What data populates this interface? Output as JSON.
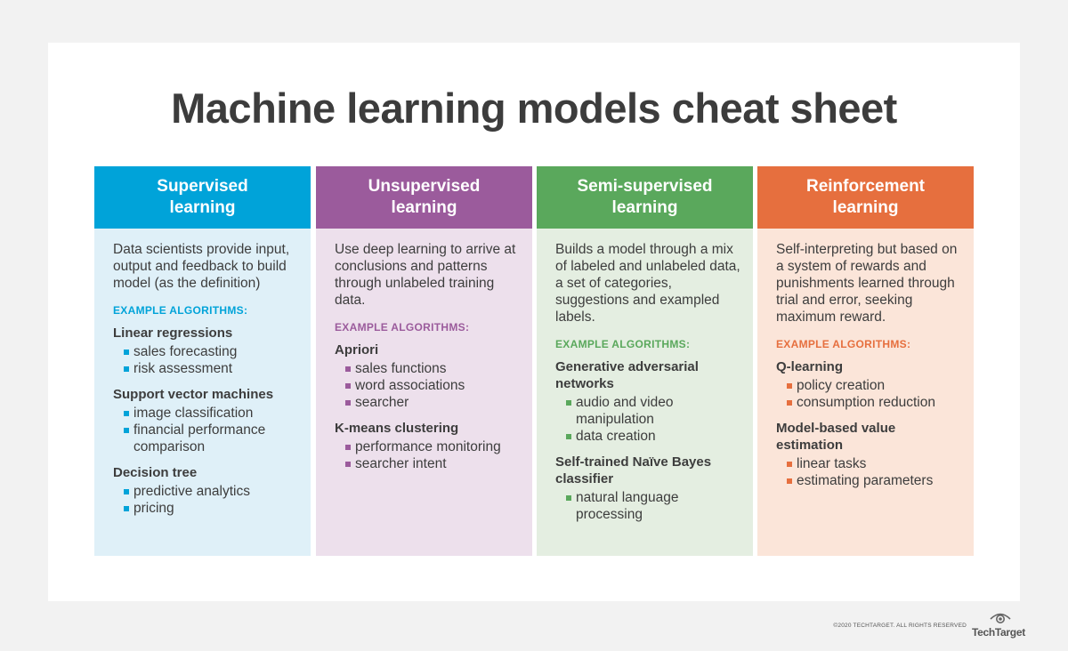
{
  "title": "Machine learning models cheat sheet",
  "columns": [
    {
      "heading_line1": "Supervised",
      "heading_line2": "learning",
      "head_color": "#00a3d9",
      "body_color": "#dff0f8",
      "accent_color": "#00a3d9",
      "description": "Data scientists provide input, output and feedback to build model (as the definition)",
      "example_label": "EXAMPLE ALGORITHMS:",
      "algorithms": [
        {
          "name": "Linear regressions",
          "uses": [
            "sales forecasting",
            "risk assessment"
          ]
        },
        {
          "name": "Support vector machines",
          "uses": [
            "image classification",
            "financial performance comparison"
          ]
        },
        {
          "name": "Decision tree",
          "uses": [
            "predictive analytics",
            "pricing"
          ]
        }
      ]
    },
    {
      "heading_line1": "Unsupervised",
      "heading_line2": "learning",
      "head_color": "#9b5b9c",
      "body_color": "#ede0ec",
      "accent_color": "#9b5b9c",
      "description": "Use deep learning to arrive at conclusions and patterns through unlabeled training data.",
      "example_label": "EXAMPLE ALGORITHMS:",
      "algorithms": [
        {
          "name": "Apriori",
          "uses": [
            "sales functions",
            "word associations",
            "searcher"
          ]
        },
        {
          "name": "K-means clustering",
          "uses": [
            "performance monitoring",
            "searcher intent"
          ]
        }
      ]
    },
    {
      "heading_line1": "Semi-supervised",
      "heading_line2": "learning",
      "head_color": "#5aa85c",
      "body_color": "#e4eee1",
      "accent_color": "#5aa85c",
      "description": "Builds a model through a mix of labeled and unlabeled data, a set of categories, suggestions and exampled labels.",
      "example_label": "EXAMPLE ALGORITHMS:",
      "algorithms": [
        {
          "name": "Generative adversarial networks",
          "uses": [
            "audio and video manipulation",
            "data creation"
          ]
        },
        {
          "name": "Self-trained Naïve Bayes classifier",
          "uses": [
            "natural language processing"
          ]
        }
      ]
    },
    {
      "heading_line1": "Reinforcement",
      "heading_line2": "learning",
      "head_color": "#e66f3e",
      "body_color": "#fbe5d9",
      "accent_color": "#e66f3e",
      "description": "Self-interpreting but based on a system of rewards and punishments learned through trial and error, seeking maximum reward.",
      "example_label": "EXAMPLE ALGORITHMS:",
      "algorithms": [
        {
          "name": "Q-learning",
          "uses": [
            "policy creation",
            "consumption reduction"
          ]
        },
        {
          "name": "Model-based value estimation",
          "uses": [
            "linear tasks",
            "estimating parameters"
          ]
        }
      ]
    }
  ],
  "footer": {
    "copyright": "©2020 TECHTARGET. ALL RIGHTS RESERVED",
    "logo_text": "TechTarget"
  }
}
